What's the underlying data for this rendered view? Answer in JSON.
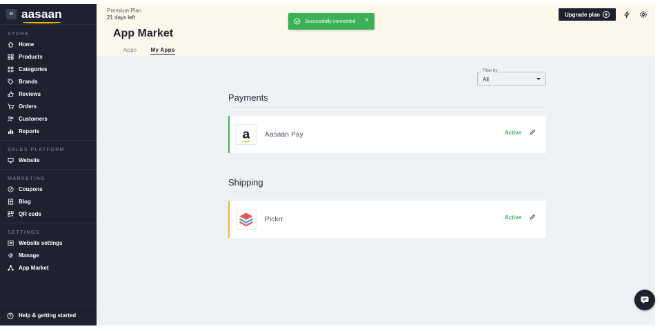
{
  "sidebar": {
    "logo": "aasaan",
    "collapse_label": "«",
    "sections": [
      {
        "title": "STORE",
        "items": [
          {
            "label": "Home",
            "icon": "home-icon"
          },
          {
            "label": "Products",
            "icon": "grid-icon"
          },
          {
            "label": "Categories",
            "icon": "categories-icon"
          },
          {
            "label": "Brands",
            "icon": "tag-icon"
          },
          {
            "label": "Reviews",
            "icon": "thumbs-up-icon"
          },
          {
            "label": "Orders",
            "icon": "cart-icon"
          },
          {
            "label": "Customers",
            "icon": "users-icon"
          },
          {
            "label": "Reports",
            "icon": "bar-chart-icon"
          }
        ]
      },
      {
        "title": "SALES PLATFORM",
        "items": [
          {
            "label": "Website",
            "icon": "monitor-icon"
          }
        ]
      },
      {
        "title": "MARKETING",
        "items": [
          {
            "label": "Coupons",
            "icon": "percent-icon"
          },
          {
            "label": "Blog",
            "icon": "blog-icon"
          },
          {
            "label": "QR code",
            "icon": "qr-code-icon"
          }
        ]
      },
      {
        "title": "SETTINGS",
        "items": [
          {
            "label": "Website settings",
            "icon": "website-settings-icon"
          },
          {
            "label": "Manage",
            "icon": "gear-icon"
          },
          {
            "label": "App Market",
            "icon": "app-market-icon"
          }
        ]
      }
    ],
    "help_label": "Help & getting started"
  },
  "header": {
    "plan_name": "Premium Plan",
    "plan_days": "21 days left",
    "title": "App Market",
    "tabs": [
      {
        "label": "Apps",
        "active": false
      },
      {
        "label": "My Apps",
        "active": true
      }
    ],
    "upgrade_label": "Upgrade plan"
  },
  "toast": {
    "message": "Successfully connected",
    "close": "×"
  },
  "filter": {
    "label": "Filter by",
    "value": "All"
  },
  "categories": [
    {
      "title": "Payments",
      "apps": [
        {
          "name": "Aasaan Pay",
          "status": "Active",
          "accent": "#3bb157"
        }
      ]
    },
    {
      "title": "Shipping",
      "apps": [
        {
          "name": "Pickrr",
          "status": "Active",
          "accent": "#f0b43c"
        }
      ]
    }
  ],
  "colors": {
    "sidebar_bg": "#1d2130",
    "header_bg": "#fcf8ec",
    "main_bg": "#eef2f5",
    "success": "#3bb157",
    "brand_yellow": "#f5b800"
  }
}
